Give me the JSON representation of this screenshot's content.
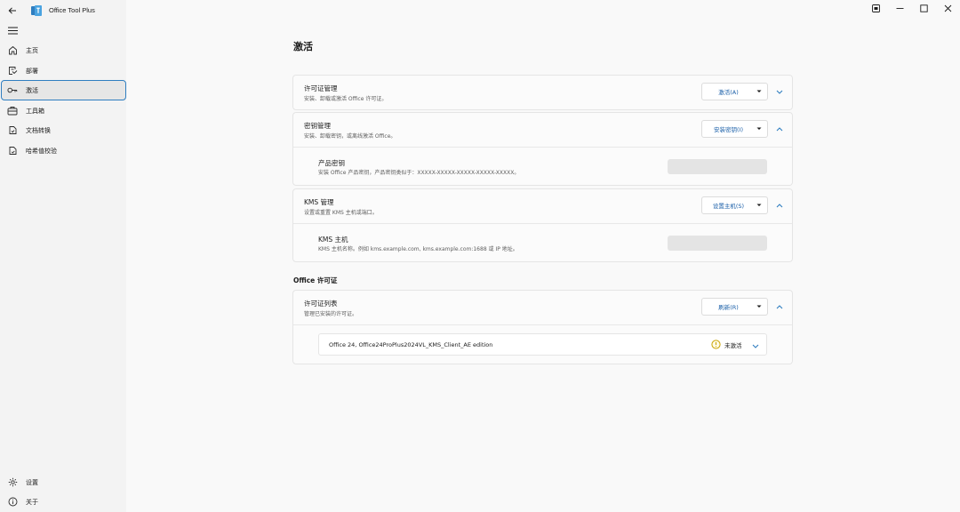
{
  "app": {
    "title": "Office Tool Plus",
    "accent_color": "#2f7ec0",
    "link_color": "#1a5fa8"
  },
  "titlebar": {
    "back_icon": "arrow-left-icon",
    "controls": [
      "compact-overlay-icon",
      "minimize-icon",
      "maximize-icon",
      "close-icon"
    ]
  },
  "sidebar": {
    "menu_icon": "hamburger-icon",
    "items": [
      {
        "label": "主页",
        "icon": "home-icon",
        "active": false
      },
      {
        "label": "部署",
        "icon": "deploy-icon",
        "active": false
      },
      {
        "label": "激活",
        "icon": "key-icon",
        "active": true
      },
      {
        "label": "工具箱",
        "icon": "toolbox-icon",
        "active": false
      },
      {
        "label": "文档转换",
        "icon": "document-convert-icon",
        "active": false
      },
      {
        "label": "哈希值校验",
        "icon": "hash-check-icon",
        "active": false
      }
    ],
    "footer_items": [
      {
        "label": "设置",
        "icon": "gear-icon"
      },
      {
        "label": "关于",
        "icon": "info-icon"
      }
    ]
  },
  "page": {
    "title": "激活"
  },
  "cards": {
    "license_mgmt": {
      "title": "许可证管理",
      "desc": "安装、卸载或激活 Office 许可证。",
      "button": "激活(A)",
      "expanded": false
    },
    "key_mgmt": {
      "title": "密钥管理",
      "desc": "安装、卸载密钥，或离线激活 Office。",
      "button": "安装密钥(I)",
      "expanded": true,
      "sub": {
        "title": "产品密钥",
        "desc": "安装 Office 产品密钥，产品密钥类似于：XXXXX-XXXXX-XXXXX-XXXXX-XXXXX。",
        "value": ""
      }
    },
    "kms_mgmt": {
      "title": "KMS 管理",
      "desc": "设置或重置 KMS 主机或端口。",
      "button": "设置主机(S)",
      "expanded": true,
      "sub": {
        "title": "KMS 主机",
        "desc": "KMS 主机名称。例如 kms.example.com, kms.example.com:1688 或 IP 地址。",
        "value": ""
      }
    }
  },
  "office_license": {
    "section_title": "Office 许可证",
    "list_card": {
      "title": "许可证列表",
      "desc": "管理已安装的许可证。",
      "button": "刷新(R)",
      "expanded": true,
      "items": [
        {
          "name": "Office 24, Office24ProPlus2024VL_KMS_Client_AE edition",
          "status": "未激活",
          "status_icon": "warning-icon",
          "status_color": "#c9a400"
        }
      ]
    }
  }
}
